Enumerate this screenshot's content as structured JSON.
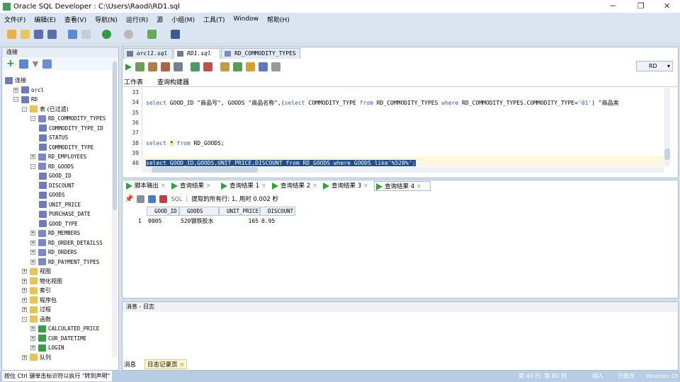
{
  "window": {
    "title": "Oracle SQL Developer : C:\\Users\\Raodi\\RD1.sql"
  },
  "menu": [
    "文件(F)",
    "编辑(E)",
    "查看(V)",
    "导航(N)",
    "运行(R)",
    "源",
    "小组(M)",
    "工具(T)",
    "Window",
    "帮助(H)"
  ],
  "connections": {
    "header": "连接",
    "tree": [
      {
        "label": "连接",
        "level": 0,
        "exp": "",
        "icon": "col",
        "mono": false
      },
      {
        "label": "orcl",
        "level": 1,
        "exp": "+",
        "icon": "col",
        "mono": true
      },
      {
        "label": "RD",
        "level": 1,
        "exp": "-",
        "icon": "col",
        "mono": true
      },
      {
        "label": "表 (已过滤)",
        "level": 2,
        "exp": "-",
        "icon": "fld",
        "mono": false
      },
      {
        "label": "RD_COMMODITY_TYPES",
        "level": 3,
        "exp": "-",
        "icon": "tbl",
        "mono": true
      },
      {
        "label": "COMMODITY_TYPE_ID",
        "level": 4,
        "exp": "",
        "icon": "col",
        "mono": true
      },
      {
        "label": "STATUS",
        "level": 4,
        "exp": "",
        "icon": "col",
        "mono": true
      },
      {
        "label": "COMMODITY_TYPE",
        "level": 4,
        "exp": "",
        "icon": "col",
        "mono": true
      },
      {
        "label": "RD_EMPLOYEES",
        "level": 3,
        "exp": "+",
        "icon": "tbl",
        "mono": true
      },
      {
        "label": "RD_GOODS",
        "level": 3,
        "exp": "-",
        "icon": "tbl",
        "mono": true
      },
      {
        "label": "GOOD_ID",
        "level": 4,
        "exp": "",
        "icon": "col",
        "mono": true
      },
      {
        "label": "DISCOUNT",
        "level": 4,
        "exp": "",
        "icon": "col",
        "mono": true
      },
      {
        "label": "GOODS",
        "level": 4,
        "exp": "",
        "icon": "col",
        "mono": true
      },
      {
        "label": "UNIT_PRICE",
        "level": 4,
        "exp": "",
        "icon": "col",
        "mono": true
      },
      {
        "label": "PURCHASE_DATE",
        "level": 4,
        "exp": "",
        "icon": "col",
        "mono": true
      },
      {
        "label": "GOOD_TYPE",
        "level": 4,
        "exp": "",
        "icon": "col",
        "mono": true
      },
      {
        "label": "RD_MEMBERS",
        "level": 3,
        "exp": "+",
        "icon": "tbl",
        "mono": true
      },
      {
        "label": "RD_ORDER_DETAILSS",
        "level": 3,
        "exp": "+",
        "icon": "tbl",
        "mono": true
      },
      {
        "label": "RD_ORDERS",
        "level": 3,
        "exp": "+",
        "icon": "tbl",
        "mono": true
      },
      {
        "label": "RD_PAYMENT_TYPES",
        "level": 3,
        "exp": "+",
        "icon": "tbl",
        "mono": true
      },
      {
        "label": "视图",
        "level": 2,
        "exp": "+",
        "icon": "fld",
        "mono": false
      },
      {
        "label": "物化视图",
        "level": 2,
        "exp": "+",
        "icon": "fld",
        "mono": false
      },
      {
        "label": "索引",
        "level": 2,
        "exp": "+",
        "icon": "fld",
        "mono": false
      },
      {
        "label": "程序包",
        "level": 2,
        "exp": "+",
        "icon": "fld",
        "mono": false
      },
      {
        "label": "过程",
        "level": 2,
        "exp": "+",
        "icon": "fld",
        "mono": false
      },
      {
        "label": "函数",
        "level": 2,
        "exp": "-",
        "icon": "fld",
        "mono": false
      },
      {
        "label": "CALCULATED_PRICE",
        "level": 3,
        "exp": "+",
        "icon": "fn",
        "mono": true
      },
      {
        "label": "CUR_DATETIME",
        "level": 3,
        "exp": "+",
        "icon": "fn",
        "mono": true
      },
      {
        "label": "LOGIN",
        "level": 3,
        "exp": "+",
        "icon": "fn",
        "mono": true
      },
      {
        "label": "队列",
        "level": 2,
        "exp": "+",
        "icon": "fld",
        "mono": false
      }
    ]
  },
  "editor": {
    "tabs": [
      "orcl1.sql",
      "RD1.sql",
      "RD_COMMODITY_TYPES"
    ],
    "connection": "RD",
    "subtabs": [
      "工作表",
      "查询构建器"
    ],
    "lines": [
      {
        "n": "33",
        "html": ""
      },
      {
        "n": "34",
        "html": "<span class='kw'>select</span> GOOD_ID \"商品号\", GOODS \"商品名称\",(<span class='kw'>select</span> COMMODITY_TYPE <span class='kw'>from</span> RD_COMMODITY_TYPES <span class='kw'>where</span> RD_COMMODITY_TYPES.COMMODITY_TYPE=<span class='str'>'01'</span>) \"商品类"
      },
      {
        "n": "35",
        "html": ""
      },
      {
        "n": "36",
        "html": ""
      },
      {
        "n": "37",
        "html": ""
      },
      {
        "n": "38",
        "html": "<span class='kw'>select</span> <span style='background:#fde9a8'>*</span> <span class='kw'>from</span> RD_GOODS;"
      },
      {
        "n": "39",
        "html": ""
      },
      {
        "n": "40",
        "html": "<span style='background:#1f4e8c;color:#fff'>select GOOD_ID,GOODS,UNIT_PRICE,DISCOUNT from RD_GOODS where GOODS like'%520%';</span>"
      }
    ]
  },
  "results": {
    "tabs": [
      "脚本输出",
      "查询结果",
      "查询结果 1",
      "查询结果 2",
      "查询结果 3",
      "查询结果 4"
    ],
    "sql_label": "SQL",
    "status": "提取的所有行: 1, 用时 0.002 秒",
    "columns": [
      "GOOD_ID",
      "GOODS",
      "UNIT_PRICE",
      "DISCOUNT"
    ],
    "rows": [
      {
        "num": "1",
        "GOOD_ID": "0005",
        "GOODS": "520钢铁胶水",
        "UNIT_PRICE": "165",
        "DISCOUNT": "0.95"
      }
    ]
  },
  "log": {
    "header": "消息 - 日志",
    "tabs": [
      "消息",
      "日志记录页"
    ]
  },
  "statusbar": {
    "hint": "按住 Ctrl 键单击标识符以执行 \"转到声明\"",
    "position": "第 40 行, 第 80 列",
    "mode": "插入",
    "state": "已修改",
    "os": "Windows: CR"
  }
}
